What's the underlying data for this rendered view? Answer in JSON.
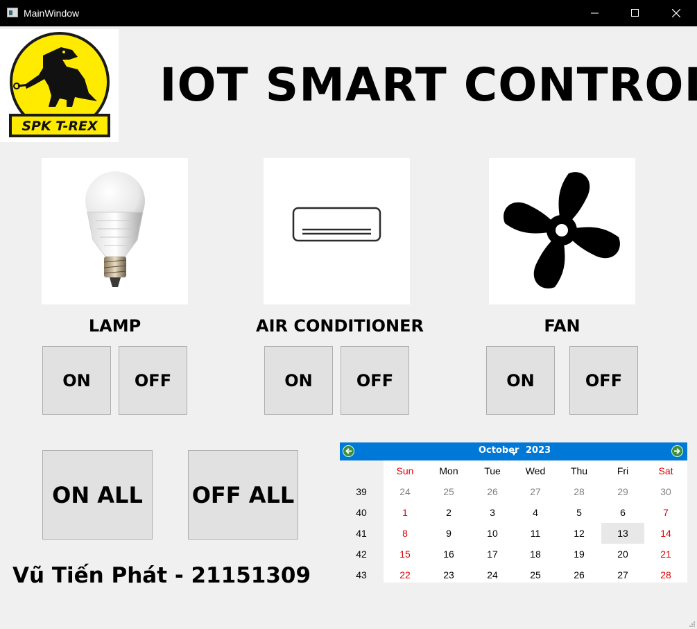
{
  "window": {
    "title": "MainWindow",
    "controls": [
      "minimize-icon",
      "maximize-icon",
      "close-icon"
    ]
  },
  "logo": {
    "text": "SPK T-REX",
    "colors": {
      "circle": "#ffeb00",
      "outline": "#1a1a1a"
    }
  },
  "header": {
    "title": "IOT SMART CONTROL"
  },
  "devices": [
    {
      "name": "LAMP",
      "icon": "lightbulb-icon",
      "on_label": "ON",
      "off_label": "OFF"
    },
    {
      "name": "AIR CONDITIONER",
      "icon": "air-conditioner-icon",
      "on_label": "ON",
      "off_label": "OFF"
    },
    {
      "name": "FAN",
      "icon": "fan-icon",
      "on_label": "ON",
      "off_label": "OFF"
    }
  ],
  "global_controls": {
    "on_all": "ON ALL",
    "off_all": "OFF ALL"
  },
  "student": {
    "text": "Vũ Tiến Phát - 21151309"
  },
  "calendar": {
    "month": "October",
    "year": "2023",
    "prev_icon": "arrow-left-icon",
    "next_icon": "arrow-right-icon",
    "header_color": "#0078d7",
    "weekdays": [
      "Sun",
      "Mon",
      "Tue",
      "Wed",
      "Thu",
      "Fri",
      "Sat"
    ],
    "selected_day": "13",
    "weeks": [
      {
        "week": "39",
        "days": [
          "24",
          "25",
          "26",
          "27",
          "28",
          "29",
          "30"
        ],
        "other_month": [
          true,
          true,
          true,
          true,
          true,
          true,
          true
        ]
      },
      {
        "week": "40",
        "days": [
          "1",
          "2",
          "3",
          "4",
          "5",
          "6",
          "7"
        ],
        "other_month": [
          false,
          false,
          false,
          false,
          false,
          false,
          false
        ]
      },
      {
        "week": "41",
        "days": [
          "8",
          "9",
          "10",
          "11",
          "12",
          "13",
          "14"
        ],
        "other_month": [
          false,
          false,
          false,
          false,
          false,
          false,
          false
        ]
      },
      {
        "week": "42",
        "days": [
          "15",
          "16",
          "17",
          "18",
          "19",
          "20",
          "21"
        ],
        "other_month": [
          false,
          false,
          false,
          false,
          false,
          false,
          false
        ]
      },
      {
        "week": "43",
        "days": [
          "22",
          "23",
          "24",
          "25",
          "26",
          "27",
          "28"
        ],
        "other_month": [
          false,
          false,
          false,
          false,
          false,
          false,
          false
        ]
      }
    ]
  }
}
